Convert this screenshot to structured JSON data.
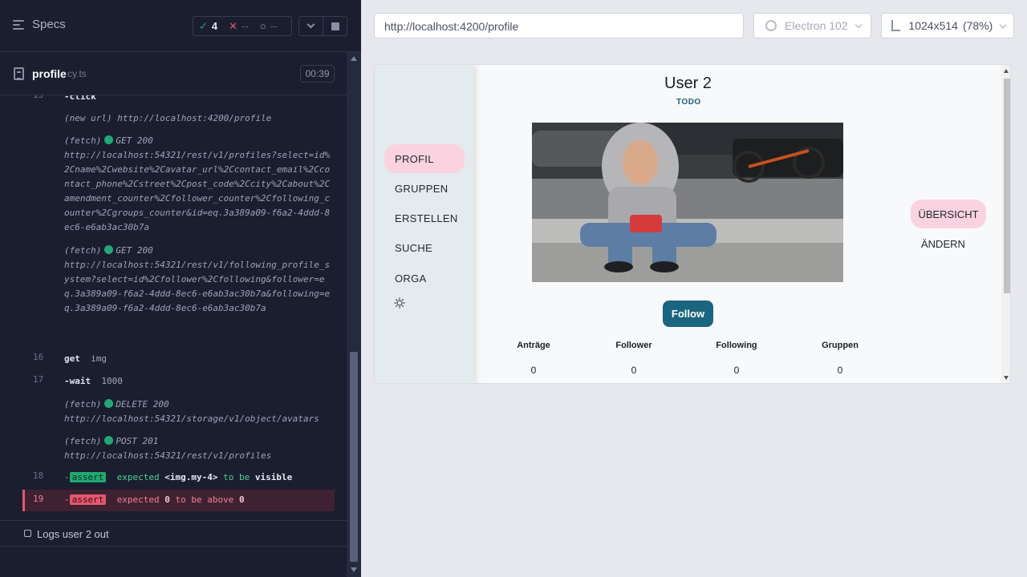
{
  "runner": {
    "specs_label": "Specs",
    "stats": {
      "passed": "4",
      "failed": "--",
      "pending": "--"
    },
    "spec_name": "profile",
    "spec_ext": "cy.ts",
    "duration": "00:39",
    "commands": {
      "c15": {
        "num": "15",
        "name": "-click"
      },
      "new_url": {
        "label": "(new url)",
        "url": "http://localhost:4200/profile"
      },
      "fetch1": {
        "label": "(fetch)",
        "method": "GET 200",
        "url": "http://localhost:54321/rest/v1/profiles?select=id%2Cname%2Cwebsite%2Cavatar_url%2Ccontact_email%2Ccontact_phone%2Cstreet%2Cpost_code%2Ccity%2Cabout%2Camendment_counter%2Cfollower_counter%2Cfollowing_counter%2Cgroups_counter&id=eq.3a389a09-f6a2-4ddd-8ec6-e6ab3ac30b7a"
      },
      "fetch2": {
        "label": "(fetch)",
        "method": "GET 200",
        "url": "http://localhost:54321/rest/v1/following_profile_system?select=id%2Cfollower%2Cfollowing&follower=eq.3a389a09-f6a2-4ddd-8ec6-e6ab3ac30b7a&following=eq.3a389a09-f6a2-4ddd-8ec6-e6ab3ac30b7a"
      },
      "c16": {
        "num": "16",
        "name": "get",
        "arg": "img"
      },
      "c17": {
        "num": "17",
        "name": "-wait",
        "arg": "1000"
      },
      "fetch3": {
        "label": "(fetch)",
        "method": "DELETE 200",
        "url": "http://localhost:54321/storage/v1/object/avatars"
      },
      "fetch4": {
        "label": "(fetch)",
        "method": "POST 201",
        "url": "http://localhost:54321/rest/v1/profiles"
      },
      "c18": {
        "num": "18",
        "dash": "-",
        "badge": "assert",
        "t1": "expected",
        "t2": "<img.my-4>",
        "t3": "to be",
        "t4": "visible"
      },
      "c19": {
        "num": "19",
        "dash": "-",
        "badge": "assert",
        "t1": "expected",
        "t2": "0",
        "t3": "to be above",
        "t4": "0"
      }
    },
    "test_title": "Logs user 2 out"
  },
  "preview": {
    "url": "http://localhost:4200/profile",
    "browser": "Electron 102",
    "viewport": "1024x514",
    "zoom": "(78%)"
  },
  "app": {
    "nav": [
      "PROFIL",
      "GRUPPEN",
      "ERSTELLEN",
      "SUCHE",
      "ORGA"
    ],
    "theme_icon": "sun-icon",
    "title": "User 2",
    "subtitle": "TODO",
    "follow": "Follow",
    "stats": [
      {
        "label": "Anträge",
        "value": "0"
      },
      {
        "label": "Follower",
        "value": "0"
      },
      {
        "label": "Following",
        "value": "0"
      },
      {
        "label": "Gruppen",
        "value": "0"
      }
    ],
    "side_menu": [
      "ÜBERSICHT",
      "ÄNDERN"
    ]
  },
  "colors": {
    "runner_bg": "#1b1e2e",
    "pass": "#1fa971",
    "fail": "#e45770",
    "nav_active": "#fbd3e0",
    "follow_btn": "#1a6680"
  }
}
